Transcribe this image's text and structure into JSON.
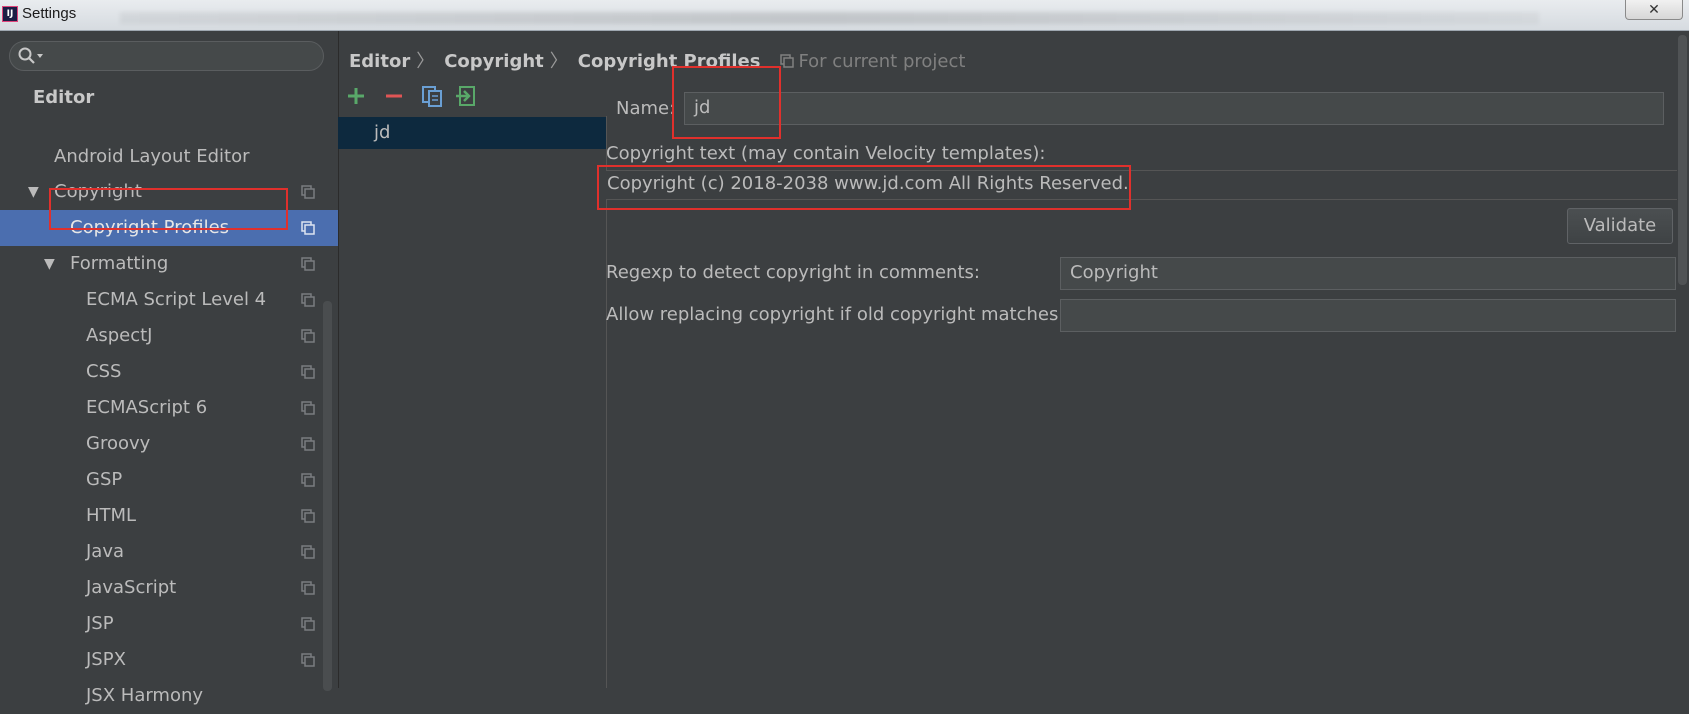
{
  "window": {
    "title": "Settings",
    "app_icon": "intellij-icon",
    "close_label": "✕"
  },
  "search": {
    "placeholder": "",
    "icon": "search-icon"
  },
  "sidebar": {
    "section_title": "Editor",
    "items": [
      {
        "label": "Android Layout Editor"
      },
      {
        "label": "Copyright"
      },
      {
        "label": "Copyright Profiles"
      },
      {
        "label": "Formatting"
      },
      {
        "label": "ECMA Script Level 4"
      },
      {
        "label": "AspectJ"
      },
      {
        "label": "CSS"
      },
      {
        "label": "ECMAScript 6"
      },
      {
        "label": "Groovy"
      },
      {
        "label": "GSP"
      },
      {
        "label": "HTML"
      },
      {
        "label": "Java"
      },
      {
        "label": "JavaScript"
      },
      {
        "label": "JSP"
      },
      {
        "label": "JSPX"
      },
      {
        "label": "JSX Harmony"
      }
    ],
    "selected": "Copyright Profiles"
  },
  "breadcrumb": {
    "parts": [
      "Editor",
      "Copyright",
      "Copyright Profiles"
    ],
    "separator": "〉",
    "scope": "For current project"
  },
  "profiles": {
    "toolbar": [
      "add-icon",
      "remove-icon",
      "copy-icon",
      "import-icon"
    ],
    "items": [
      "jd"
    ]
  },
  "form": {
    "name_label": "Name:",
    "name_value": "jd",
    "copyright_text_label": "Copyright text (may contain Velocity templates):",
    "copyright_text": "Copyright (c) 2018-2038 www.jd.com All Rights Reserved.",
    "validate_label": "Validate",
    "regexp_label": "Regexp to detect copyright in comments:",
    "regexp_value": "Copyright",
    "allow_replace_label": "Allow replacing copyright if old copyright matches:",
    "allow_replace_value": ""
  },
  "colors": {
    "background": "#3c3f41",
    "selection": "#4b6eaf",
    "list_selection": "#0d293e",
    "highlight": "#e0302c",
    "add": "#59a869",
    "remove": "#e05555"
  }
}
